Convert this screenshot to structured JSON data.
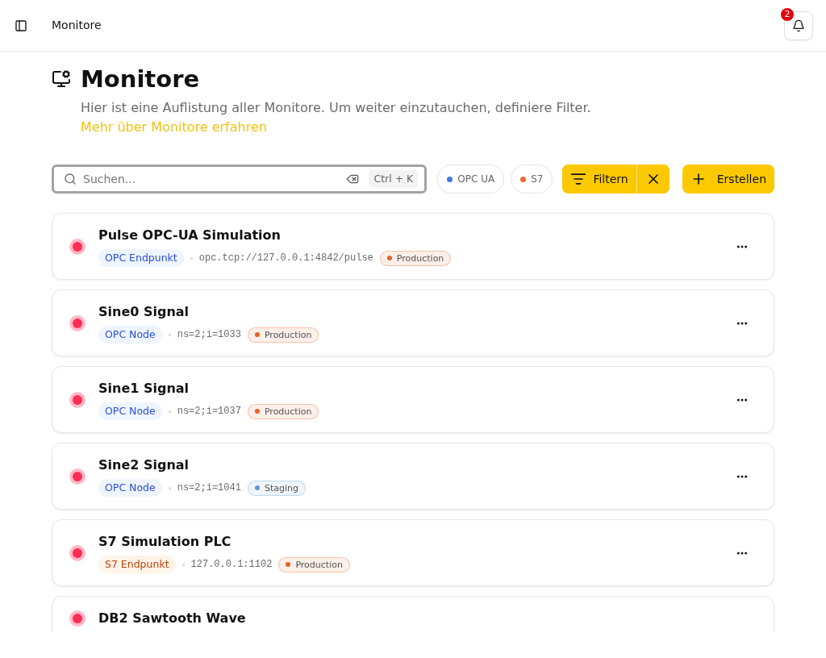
{
  "header": {
    "title": "Monitore",
    "notifications": "2"
  },
  "page": {
    "title": "Monitore",
    "description": "Hier ist eine Auflistung aller Monitore. Um weiter einzutauchen, definiere Filter.",
    "link": "Mehr über Monitore erfahren"
  },
  "toolbar": {
    "search": {
      "placeholder": "Suchen...",
      "shortcut": "Ctrl + K",
      "focused": true
    },
    "chips": [
      {
        "label": "OPC UA",
        "color": "#3b7ddd"
      },
      {
        "label": "S7",
        "color": "#ee6a2c"
      }
    ],
    "filter_button": "Filtern",
    "create_button": "Erstellen"
  },
  "monitors": [
    {
      "name": "Pulse OPC-UA Simulation",
      "color": "#ff2d55",
      "type": {
        "kind": "opc",
        "label": "OPC Endpunkt"
      },
      "address": "opc.tcp://127.0.0.1:4842/pulse",
      "environment": {
        "label": "Production",
        "color": "#e8622a"
      }
    },
    {
      "name": "Sine0 Signal",
      "color": "#ff2d55",
      "type": {
        "kind": "opc",
        "label": "OPC Node"
      },
      "address": "ns=2;i=1033",
      "environment": {
        "label": "Production",
        "color": "#e8622a"
      }
    },
    {
      "name": "Sine1 Signal",
      "color": "#ff2d55",
      "type": {
        "kind": "opc",
        "label": "OPC Node"
      },
      "address": "ns=2;i=1037",
      "environment": {
        "label": "Production",
        "color": "#e8622a"
      }
    },
    {
      "name": "Sine2 Signal",
      "color": "#ff2d55",
      "type": {
        "kind": "opc",
        "label": "OPC Node"
      },
      "address": "ns=2;i=1041",
      "environment": {
        "label": "Staging",
        "color": "#5a9bd5"
      }
    },
    {
      "name": "S7 Simulation PLC",
      "color": "#ff2d55",
      "type": {
        "kind": "s7",
        "label": "S7 Endpunkt"
      },
      "address": "127.0.0.1:1102",
      "environment": {
        "label": "Production",
        "color": "#e8622a"
      }
    },
    {
      "name": "DB2 Sawtooth Wave",
      "color": "#ff2d55"
    }
  ]
}
